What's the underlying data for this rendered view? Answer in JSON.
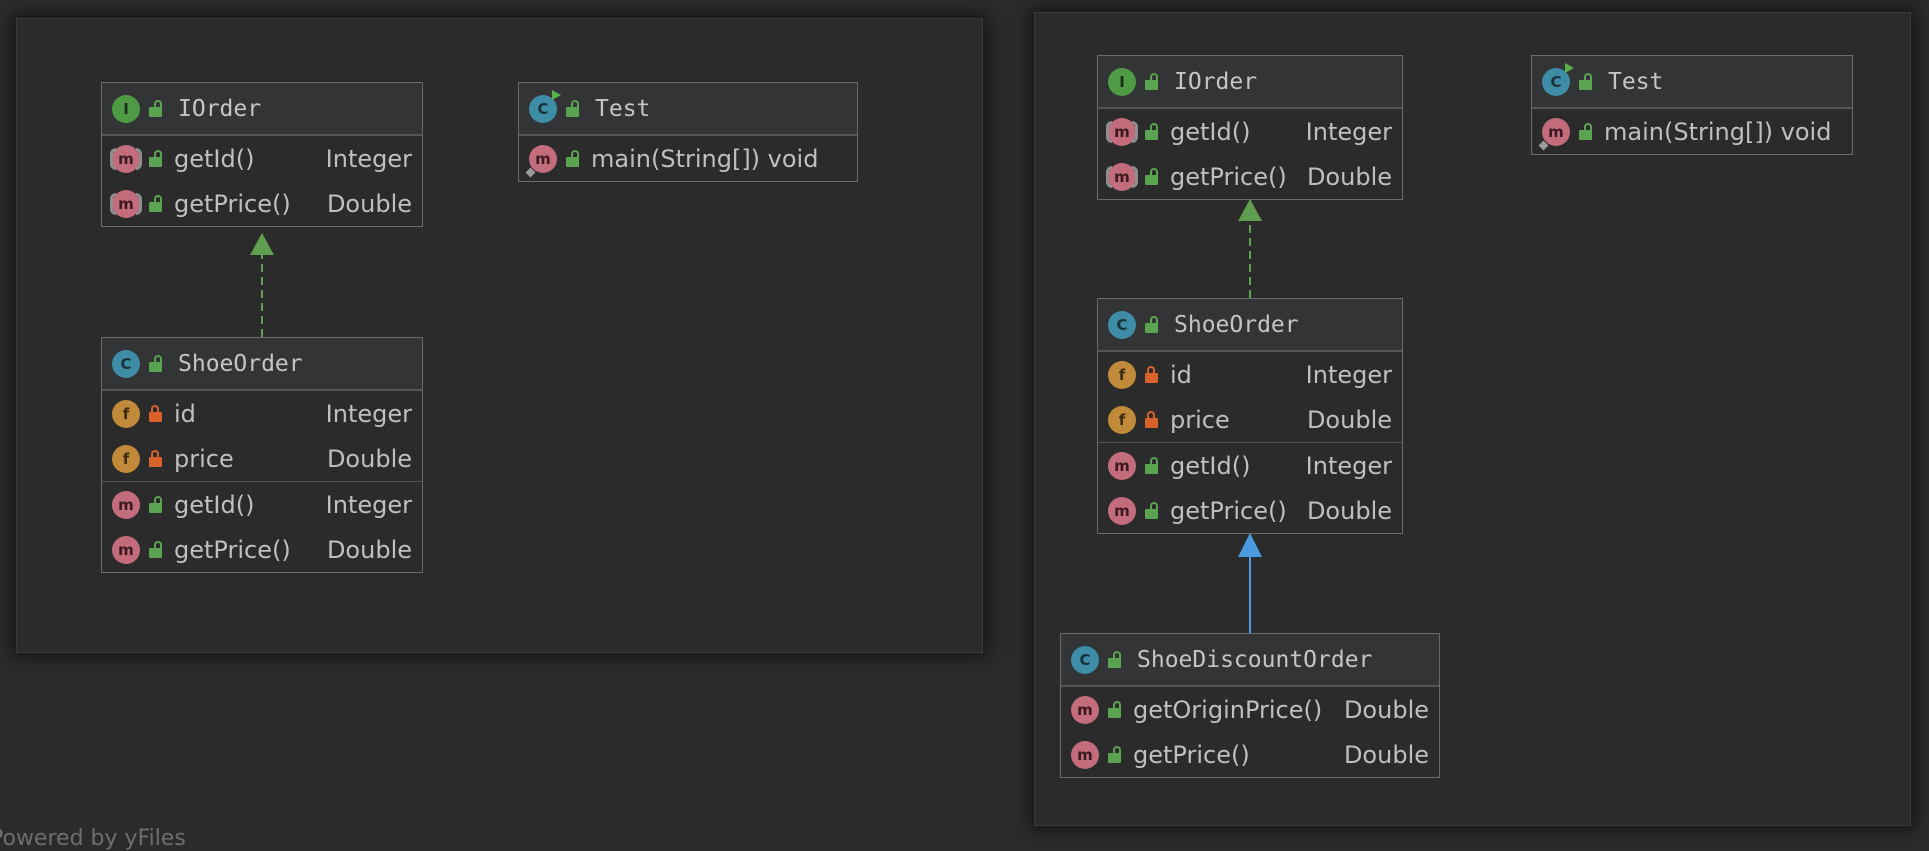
{
  "footer": "Powered by yFiles",
  "icons": {
    "interface_kind": "interface-icon",
    "class_kind": "class-icon",
    "field_kind": "field-icon",
    "method_kind": "method-icon",
    "public_vis": "unlocked-icon",
    "private_vis": "lock-icon"
  },
  "colors": {
    "background": "#2b2b2b",
    "implements_edge": "#5f9e4f",
    "extends_edge": "#4a9be0",
    "interface_badge": "#4f9a45",
    "class_badge": "#3e8ca6",
    "field_badge": "#c08a3a",
    "method_badge": "#c26c7c",
    "private_lock": "#d9622b",
    "public_lock": "#5aa350"
  },
  "left": {
    "iorder": {
      "kind": "I",
      "name": "IOrder",
      "methods": [
        {
          "name": "getId()",
          "type": "Integer"
        },
        {
          "name": "getPrice()",
          "type": "Double"
        }
      ]
    },
    "test": {
      "kind": "C",
      "name": "Test",
      "methods": [
        {
          "name": "main(String[]) void",
          "type": ""
        }
      ]
    },
    "shoeorder": {
      "kind": "C",
      "name": "ShoeOrder",
      "fields": [
        {
          "badge": "f",
          "name": "id",
          "type": "Integer"
        },
        {
          "badge": "f",
          "name": "price",
          "type": "Double"
        }
      ],
      "methods": [
        {
          "name": "getId()",
          "type": "Integer"
        },
        {
          "name": "getPrice()",
          "type": "Double"
        }
      ]
    }
  },
  "right": {
    "iorder": {
      "kind": "I",
      "name": "IOrder",
      "methods": [
        {
          "name": "getId()",
          "type": "Integer"
        },
        {
          "name": "getPrice()",
          "type": "Double"
        }
      ]
    },
    "test": {
      "kind": "C",
      "name": "Test",
      "methods": [
        {
          "name": "main(String[]) void",
          "type": ""
        }
      ]
    },
    "shoeorder": {
      "kind": "C",
      "name": "ShoeOrder",
      "fields": [
        {
          "badge": "f",
          "name": "id",
          "type": "Integer"
        },
        {
          "badge": "f",
          "name": "price",
          "type": "Double"
        }
      ],
      "methods": [
        {
          "name": "getId()",
          "type": "Integer"
        },
        {
          "name": "getPrice()",
          "type": "Double"
        }
      ]
    },
    "shoediscountorder": {
      "kind": "C",
      "name": "ShoeDiscountOrder",
      "methods": [
        {
          "name": "getOriginPrice()",
          "type": "Double"
        },
        {
          "name": "getPrice()",
          "type": "Double"
        }
      ]
    }
  },
  "badge_letter_method": "m"
}
